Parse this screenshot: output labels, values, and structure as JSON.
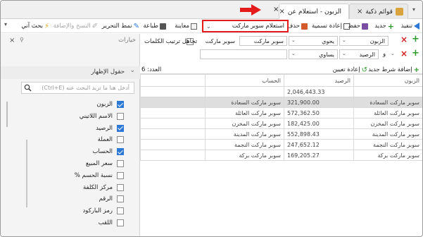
{
  "tabs": [
    {
      "label": "الزبون - استعلام عن",
      "active": true
    },
    {
      "label": "قوائم ذكية",
      "active": false
    }
  ],
  "toolbar": {
    "execute": "تنفيذ",
    "new": "جديد",
    "save": "حفظ",
    "rename": "إعادة تسمية",
    "delete": "حذف",
    "query_name": "استعلام سوبر ماركت",
    "preview": "معاينة",
    "print": "طباعة",
    "edit_style": "نمط التحرير",
    "copy_format": "النسخ والإضافة",
    "search_me": "بحث آني"
  },
  "conditions": {
    "row1": {
      "field": "الزبون",
      "operator": "يحوي",
      "value": "سوبر ماركت",
      "value2": "سوبر ماركت",
      "ignore_order_label": "تجاهل ترتيب الكلمات"
    },
    "row2": {
      "connector": "و",
      "field": "الرصيد",
      "operator": "يساوي"
    },
    "add_condition": "إضافة شرط جديد",
    "reset": "إعادة تعيين",
    "count_label": "العدد: 6"
  },
  "grid": {
    "columns": [
      "الزبون",
      "الرصيد",
      "الحساب"
    ],
    "total": "2,046,443.33",
    "rows": [
      {
        "customer": "سوبر ماركت السعادة",
        "balance": "321,900.00",
        "account": "سوبر ماركت السعادة"
      },
      {
        "customer": "سوبر ماركت العائلة",
        "balance": "572,362.50",
        "account": "سوبر ماركت العائلة"
      },
      {
        "customer": "سوبر ماركت المخزن",
        "balance": "182,425.00",
        "account": "سوبر ماركت المخزن"
      },
      {
        "customer": "سوبر ماركت المدينة",
        "balance": "552,898.43",
        "account": "سوبر ماركت المدينة"
      },
      {
        "customer": "سوبر ماركت النجمة",
        "balance": "247,652.12",
        "account": "سوبر ماركت النجمة"
      },
      {
        "customer": "سوبر ماركت بركة",
        "balance": "169,205.27",
        "account": "سوبر ماركت بركة"
      }
    ]
  },
  "panel": {
    "title": "خيارات",
    "section": "حقول الإظهار",
    "search_placeholder": "أدخل هنا ما تريد البحث عنه (Ctrl+E)",
    "fields": [
      {
        "label": "الزبون",
        "checked": true
      },
      {
        "label": "الاسم اللاتيني",
        "checked": false
      },
      {
        "label": "الرصيد",
        "checked": true
      },
      {
        "label": "العملة",
        "checked": false
      },
      {
        "label": "الحساب",
        "checked": true
      },
      {
        "label": "سعر المبيع",
        "checked": false
      },
      {
        "label": "نسبة الحسم %",
        "checked": false
      },
      {
        "label": "مركز الكلفة",
        "checked": false
      },
      {
        "label": "الرقم",
        "checked": false
      },
      {
        "label": "رمز الباركود",
        "checked": false
      },
      {
        "label": "اللقب",
        "checked": false
      }
    ]
  },
  "colors": {
    "accent": "#2b78d6",
    "highlight_border": "#e31b1b",
    "add_green": "#2a9a2a",
    "remove_red": "#d21f1f"
  }
}
